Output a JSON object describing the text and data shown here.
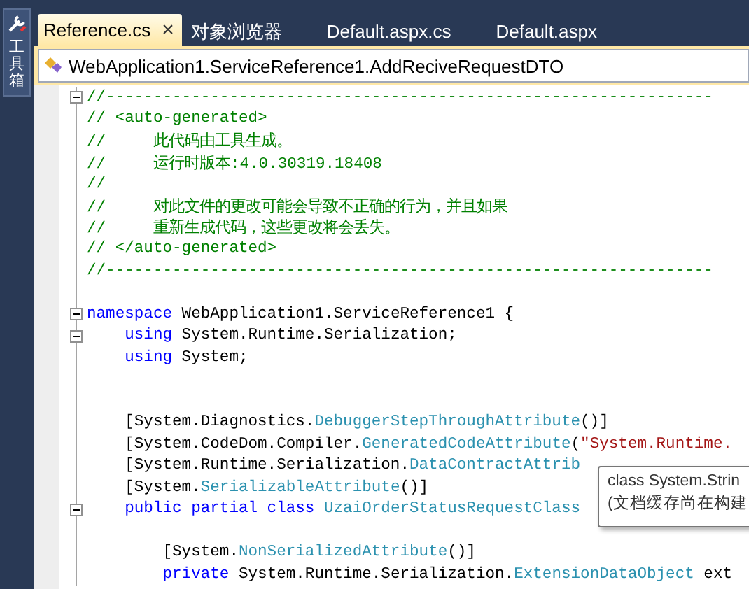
{
  "toolbox": {
    "label": "工具箱"
  },
  "tabs": [
    {
      "label": "Reference.cs",
      "selected": true,
      "close": "×"
    },
    {
      "label": "对象浏览器",
      "selected": false
    },
    {
      "label": "Default.aspx.cs",
      "selected": false
    },
    {
      "label": "Default.aspx",
      "selected": false
    }
  ],
  "navigation": {
    "type_name": "WebApplication1.ServiceReference1.AddReciveRequestDTO"
  },
  "code_lines": [
    {
      "fold_marker": true,
      "tokens": [
        {
          "kind": "comment",
          "text": "//----------------------------------------------------------------"
        }
      ]
    },
    {
      "fold_marker": false,
      "tokens": [
        {
          "kind": "comment",
          "text": "// <auto-generated>"
        }
      ]
    },
    {
      "fold_marker": false,
      "tokens": [
        {
          "kind": "comment",
          "text": "//     此代码由工具生成。"
        }
      ]
    },
    {
      "fold_marker": false,
      "tokens": [
        {
          "kind": "comment",
          "text": "//     运行时版本:4.0.30319.18408"
        }
      ]
    },
    {
      "fold_marker": false,
      "tokens": [
        {
          "kind": "comment",
          "text": "//"
        }
      ]
    },
    {
      "fold_marker": false,
      "tokens": [
        {
          "kind": "comment",
          "text": "//     对此文件的更改可能会导致不正确的行为，并且如果"
        }
      ]
    },
    {
      "fold_marker": false,
      "tokens": [
        {
          "kind": "comment",
          "text": "//     重新生成代码，这些更改将会丢失。"
        }
      ]
    },
    {
      "fold_marker": false,
      "tokens": [
        {
          "kind": "comment",
          "text": "// </auto-generated>"
        }
      ]
    },
    {
      "fold_marker": false,
      "tokens": [
        {
          "kind": "comment",
          "text": "//----------------------------------------------------------------"
        }
      ]
    },
    {
      "fold_marker": false
    },
    {
      "fold_marker": true,
      "tokens": [
        {
          "kind": "keyword",
          "text": "namespace"
        },
        {
          "kind": "plain",
          "text": " WebApplication1.ServiceReference1 {"
        }
      ]
    },
    {
      "fold_marker": true,
      "tokens": [
        {
          "kind": "keyword",
          "text": "    using"
        },
        {
          "kind": "plain",
          "text": " System.Runtime.Serialization;"
        }
      ]
    },
    {
      "fold_marker": false,
      "tokens": [
        {
          "kind": "keyword",
          "text": "    using"
        },
        {
          "kind": "plain",
          "text": " System;"
        }
      ]
    },
    {
      "fold_marker": false
    },
    {
      "fold_marker": false
    },
    {
      "fold_marker": false,
      "tokens": [
        {
          "kind": "plain",
          "text": "    [System.Diagnostics."
        },
        {
          "kind": "type",
          "text": "DebuggerStepThroughAttribute"
        },
        {
          "kind": "plain",
          "text": "()]"
        }
      ]
    },
    {
      "fold_marker": false,
      "tokens": [
        {
          "kind": "plain",
          "text": "    [System.CodeDom.Compiler."
        },
        {
          "kind": "type",
          "text": "GeneratedCodeAttribute"
        },
        {
          "kind": "plain",
          "text": "("
        },
        {
          "kind": "string",
          "text": "\"System.Runtime."
        }
      ]
    },
    {
      "fold_marker": false,
      "tokens": [
        {
          "kind": "plain",
          "text": "    [System.Runtime.Serialization."
        },
        {
          "kind": "type",
          "text": "DataContractAttrib"
        }
      ]
    },
    {
      "fold_marker": false,
      "tokens": [
        {
          "kind": "plain",
          "text": "    [System."
        },
        {
          "kind": "type",
          "text": "SerializableAttribute"
        },
        {
          "kind": "plain",
          "text": "()]"
        }
      ]
    },
    {
      "fold_marker": true,
      "tokens": [
        {
          "kind": "keyword",
          "text": "    public partial class "
        },
        {
          "kind": "type",
          "text": "UzaiOrderStatusRequestClass"
        }
      ]
    },
    {
      "fold_marker": false
    },
    {
      "fold_marker": false,
      "tokens": [
        {
          "kind": "plain",
          "text": "        [System."
        },
        {
          "kind": "type",
          "text": "NonSerializedAttribute"
        },
        {
          "kind": "plain",
          "text": "()]"
        }
      ]
    },
    {
      "fold_marker": false,
      "tokens": [
        {
          "kind": "keyword",
          "text": "        private"
        },
        {
          "kind": "plain",
          "text": " System.Runtime.Serialization."
        },
        {
          "kind": "type",
          "text": "ExtensionDataObject"
        },
        {
          "kind": "plain",
          "text": " ext"
        }
      ]
    }
  ],
  "tooltip": {
    "lines": [
      "class System.Strin",
      "(文档缓存尚在构建"
    ]
  }
}
